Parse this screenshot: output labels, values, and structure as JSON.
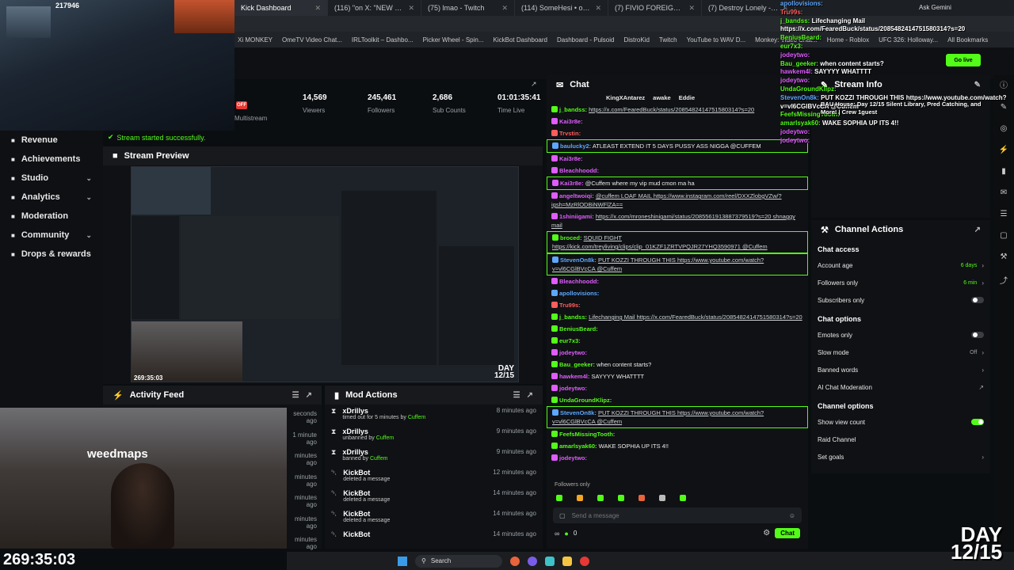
{
  "browser": {
    "tabs": [
      {
        "label": "Kick Dashboard",
        "active": true
      },
      {
        "label": "(116) \"on X: \"NEW NINE V...",
        "active": false
      },
      {
        "label": "(75) lmao - Twitch",
        "active": false
      },
      {
        "label": "(114) SomeHesi • on X: \"...",
        "active": false
      },
      {
        "label": "(7) FIVIO FOREIGN - ENTERED...",
        "active": false
      },
      {
        "label": "(7) Destroy Lonely - MONSTER...",
        "active": false
      }
    ],
    "bookmarks": [
      "Xi MONKEY",
      "OmeTV Video Chat...",
      "IRLToolkit – Dashbo...",
      "Picker Wheel - Spin...",
      "KickBot Dashboard",
      "Dashboard - Pulsoid",
      "DistroKid",
      "Twitch",
      "YouTube to WAV D...",
      "Monkey: Video Chat...",
      "Home - Roblox",
      "UFC 326: Holloway...",
      "All Bookmarks"
    ],
    "ask_gemini": "Ask Gemini"
  },
  "webcam": {
    "counter": "217946",
    "weedmaps": "weedmaps",
    "timer": "269:35:03",
    "day_badge_line1": "DAY",
    "day_badge_line2": "12/15"
  },
  "sidebar": {
    "items": [
      {
        "label": "Revenue",
        "chevron": false
      },
      {
        "label": "Achievements",
        "chevron": false
      },
      {
        "label": "Studio",
        "chevron": true
      },
      {
        "label": "Analytics",
        "chevron": true
      },
      {
        "label": "Moderation",
        "chevron": false
      },
      {
        "label": "Community",
        "chevron": true
      },
      {
        "label": "Drops & rewards",
        "chevron": false
      }
    ]
  },
  "dashboard": {
    "off_badge": "OFF",
    "multistream": "Multistream",
    "notice": "Stream started successfully.",
    "stats": [
      {
        "value": "14,569",
        "label": "Viewers"
      },
      {
        "value": "245,461",
        "label": "Followers"
      },
      {
        "value": "2,686",
        "label": "Sub Counts"
      },
      {
        "value": "01:01:35:41",
        "label": "Time Live"
      }
    ],
    "stream_preview_title": "Stream Preview",
    "activity_feed_title": "Activity Feed",
    "activity_times": [
      "seconds ago",
      "1 minute ago",
      "minutes ago",
      "minutes ago",
      "minutes ago",
      "minutes ago",
      "minutes ago"
    ],
    "mod_actions_title": "Mod Actions",
    "mod_actions": [
      {
        "user": "xDrillys",
        "action": "timed out for 5 minutes by",
        "by": "Cuffem",
        "time": "8 minutes ago"
      },
      {
        "user": "xDrillys",
        "action": "unbanned by",
        "by": "Cuffem",
        "time": "9 minutes ago"
      },
      {
        "user": "xDrillys",
        "action": "banned by",
        "by": "Cuffem",
        "time": "9 minutes ago"
      },
      {
        "user": "KickBot",
        "action": "deleted a message",
        "by": "",
        "time": "12 minutes ago"
      },
      {
        "user": "KickBot",
        "action": "deleted a message",
        "by": "",
        "time": "14 minutes ago"
      },
      {
        "user": "KickBot",
        "action": "deleted a message",
        "by": "",
        "time": "14 minutes ago"
      },
      {
        "user": "KickBot",
        "action": "",
        "by": "",
        "time": "14 minutes ago"
      }
    ]
  },
  "chat": {
    "title": "Chat",
    "pinned_users": [
      "KingXAntarez",
      "awake",
      "Eddie"
    ],
    "messages": [
      {
        "user": "j_bandss:",
        "color": "#53fc18",
        "text": "https://x.com/FearedBuck/status/2085482414751580314?s=20",
        "link": true,
        "hl": false
      },
      {
        "user": "Kai3r8e:",
        "color": "#e05cff",
        "text": "",
        "link": false,
        "hl": false
      },
      {
        "user": "Trvstin:",
        "color": "#ff5c5c",
        "text": "",
        "link": false,
        "hl": false
      },
      {
        "user": "baulucky2:",
        "color": "#5ca8ff",
        "text": "ATLEAST EXTEND IT 5 DAYS PUSSY ASS NIGGA @CUFFEM",
        "link": false,
        "hl": true
      },
      {
        "user": "Kai3r8e:",
        "color": "#e05cff",
        "text": "",
        "link": false,
        "hl": false
      },
      {
        "user": "Bleachhoodd:",
        "color": "#e05cff",
        "text": "",
        "link": false,
        "hl": false
      },
      {
        "user": "Kai3r8e:",
        "color": "#e05cff",
        "text": "@Cuffem where my vip mud cmon ma ha",
        "link": false,
        "hl": true
      },
      {
        "user": "angeltwoiqi:",
        "color": "#e05cff",
        "text": "@cuffem LOAF MAIL https://www.instagram.com/reel/DXXZlobgVZw/?igsh=MzRlODBiNWFlZA==",
        "link": true,
        "hl": false
      },
      {
        "user": "1shiniigami:",
        "color": "#e05cff",
        "text": "https://x.com/mroneshinigami/status/2085561913887379519?s=20 shnaggy mail",
        "link": true,
        "hl": false
      },
      {
        "user": "broced:",
        "color": "#53fc18",
        "text": "SQUID FIGHT https://kick.com/treyliving/clips/clip_01KZF1ZRTVPQJR27YHQ3590971 @Cuffem",
        "link": true,
        "hl": true
      },
      {
        "user": "StevenOn8k:",
        "color": "#5ca8ff",
        "text": "PUT KOZZI THROUGH THIS https://www.youtube.com/watch?v=vl6CGlBVcCA @Cuffem",
        "link": true,
        "hl": true
      },
      {
        "user": "Bleachhoodd:",
        "color": "#e05cff",
        "text": "",
        "link": false,
        "hl": false
      },
      {
        "user": "apollovisions:",
        "color": "#5ca8ff",
        "text": "",
        "link": false,
        "hl": false
      },
      {
        "user": "Tru99s:",
        "color": "#ff5c5c",
        "text": "",
        "link": false,
        "hl": false
      },
      {
        "user": "j_bandss:",
        "color": "#53fc18",
        "text": "Lifechanging Mail https://x.com/FearedBuck/status/2085482414751580314?s=20",
        "link": true,
        "hl": false
      },
      {
        "user": "BeniusBeard:",
        "color": "#53fc18",
        "text": "",
        "link": false,
        "hl": false
      },
      {
        "user": "eur7x3:",
        "color": "#53fc18",
        "text": "",
        "link": false,
        "hl": false
      },
      {
        "user": "jodeytwo:",
        "color": "#e05cff",
        "text": "",
        "link": false,
        "hl": false
      },
      {
        "user": "Bau_geeker:",
        "color": "#53fc18",
        "text": "when content starts?",
        "link": false,
        "hl": false
      },
      {
        "user": "hawkem4l:",
        "color": "#e05cff",
        "text": "SAYYYY WHATTTT",
        "link": false,
        "hl": false
      },
      {
        "user": "jodeytwo:",
        "color": "#e05cff",
        "text": "",
        "link": false,
        "hl": false
      },
      {
        "user": "UndaGroundKlipz:",
        "color": "#53fc18",
        "text": "",
        "link": false,
        "hl": false
      },
      {
        "user": "StevenOn8k:",
        "color": "#5ca8ff",
        "text": "PUT KOZZI THROUGH THIS https://www.youtube.com/watch?v=vl6CGlBVcCA @Cuffem",
        "link": true,
        "hl": true
      },
      {
        "user": "FeefsMissingTooth:",
        "color": "#53fc18",
        "text": "",
        "link": false,
        "hl": false
      },
      {
        "user": "amarlsyak60:",
        "color": "#53fc18",
        "text": "WAKE SOPHIA UP ITS 4!!",
        "link": false,
        "hl": false
      },
      {
        "user": "jodeytwo:",
        "color": "#e05cff",
        "text": "",
        "link": false,
        "hl": false
      }
    ],
    "followers_only": "Followers only",
    "input_placeholder": "Send a message",
    "send_label": "Chat",
    "counter": "0"
  },
  "stream_info": {
    "title": "Stream Info"
  },
  "channel_actions": {
    "title": "Channel Actions",
    "sections": [
      {
        "heading": "Chat access",
        "rows": [
          {
            "label": "Account age",
            "value": "6 days",
            "kind": "chevron"
          },
          {
            "label": "Followers only",
            "value": "6 min",
            "kind": "chevron"
          },
          {
            "label": "Subscribers only",
            "value": "",
            "kind": "toggle-off"
          }
        ]
      },
      {
        "heading": "Chat options",
        "rows": [
          {
            "label": "Emotes only",
            "value": "",
            "kind": "toggle-off"
          },
          {
            "label": "Slow mode",
            "value": "Off",
            "kind": "chevron"
          },
          {
            "label": "Banned words",
            "value": "",
            "kind": "chevron"
          },
          {
            "label": "AI Chat Moderation",
            "value": "",
            "kind": "external"
          }
        ]
      },
      {
        "heading": "Channel options",
        "rows": [
          {
            "label": "Show view count",
            "value": "",
            "kind": "toggle-on"
          },
          {
            "label": "Raid Channel",
            "value": "",
            "kind": "none"
          },
          {
            "label": "Set goals",
            "value": "",
            "kind": "chevron"
          }
        ]
      }
    ]
  },
  "overlay_chat": [
    {
      "user": "apollovisions:",
      "text": ""
    },
    {
      "user": "Tru99s:",
      "text": ""
    },
    {
      "user": "j_bandss:",
      "text": "Lifechanging Mail"
    },
    {
      "user": "",
      "text": "https://x.com/FearedBuck/status/2085482414751580314?s=20"
    },
    {
      "user": "BeniusBeard:",
      "text": ""
    },
    {
      "user": "eur7x3:",
      "text": ""
    },
    {
      "user": "jodeytwo:",
      "text": ""
    },
    {
      "user": "Bau_geeker:",
      "text": "when content starts?"
    },
    {
      "user": "hawkem4l:",
      "text": "SAYYYY WHATTTT"
    },
    {
      "user": "jodeytwo:",
      "text": ""
    },
    {
      "user": "UndaGroundKlipz:",
      "text": ""
    },
    {
      "user": "StevenOn8k:",
      "text": "PUT KOZZI THROUGH THIS https://www.youtube.com/watch?"
    },
    {
      "user": "",
      "text": "v=vl6CGlBVcCA @Cuffem"
    },
    {
      "user": "FeefsMissingTooth:",
      "text": ""
    },
    {
      "user": "amarlsyak60:",
      "text": "WAKE SOPHIA UP ITS 4!!"
    },
    {
      "user": "jodeytwo:",
      "text": ""
    },
    {
      "user": "jodeytwo:",
      "text": ""
    }
  ],
  "stream_info_overlay": "BAU House: Day 12/15 Silent Library, Pred Catching, and More! | Crew 1guest",
  "taskbar": {
    "search": "Search"
  },
  "go_live": "Go live"
}
